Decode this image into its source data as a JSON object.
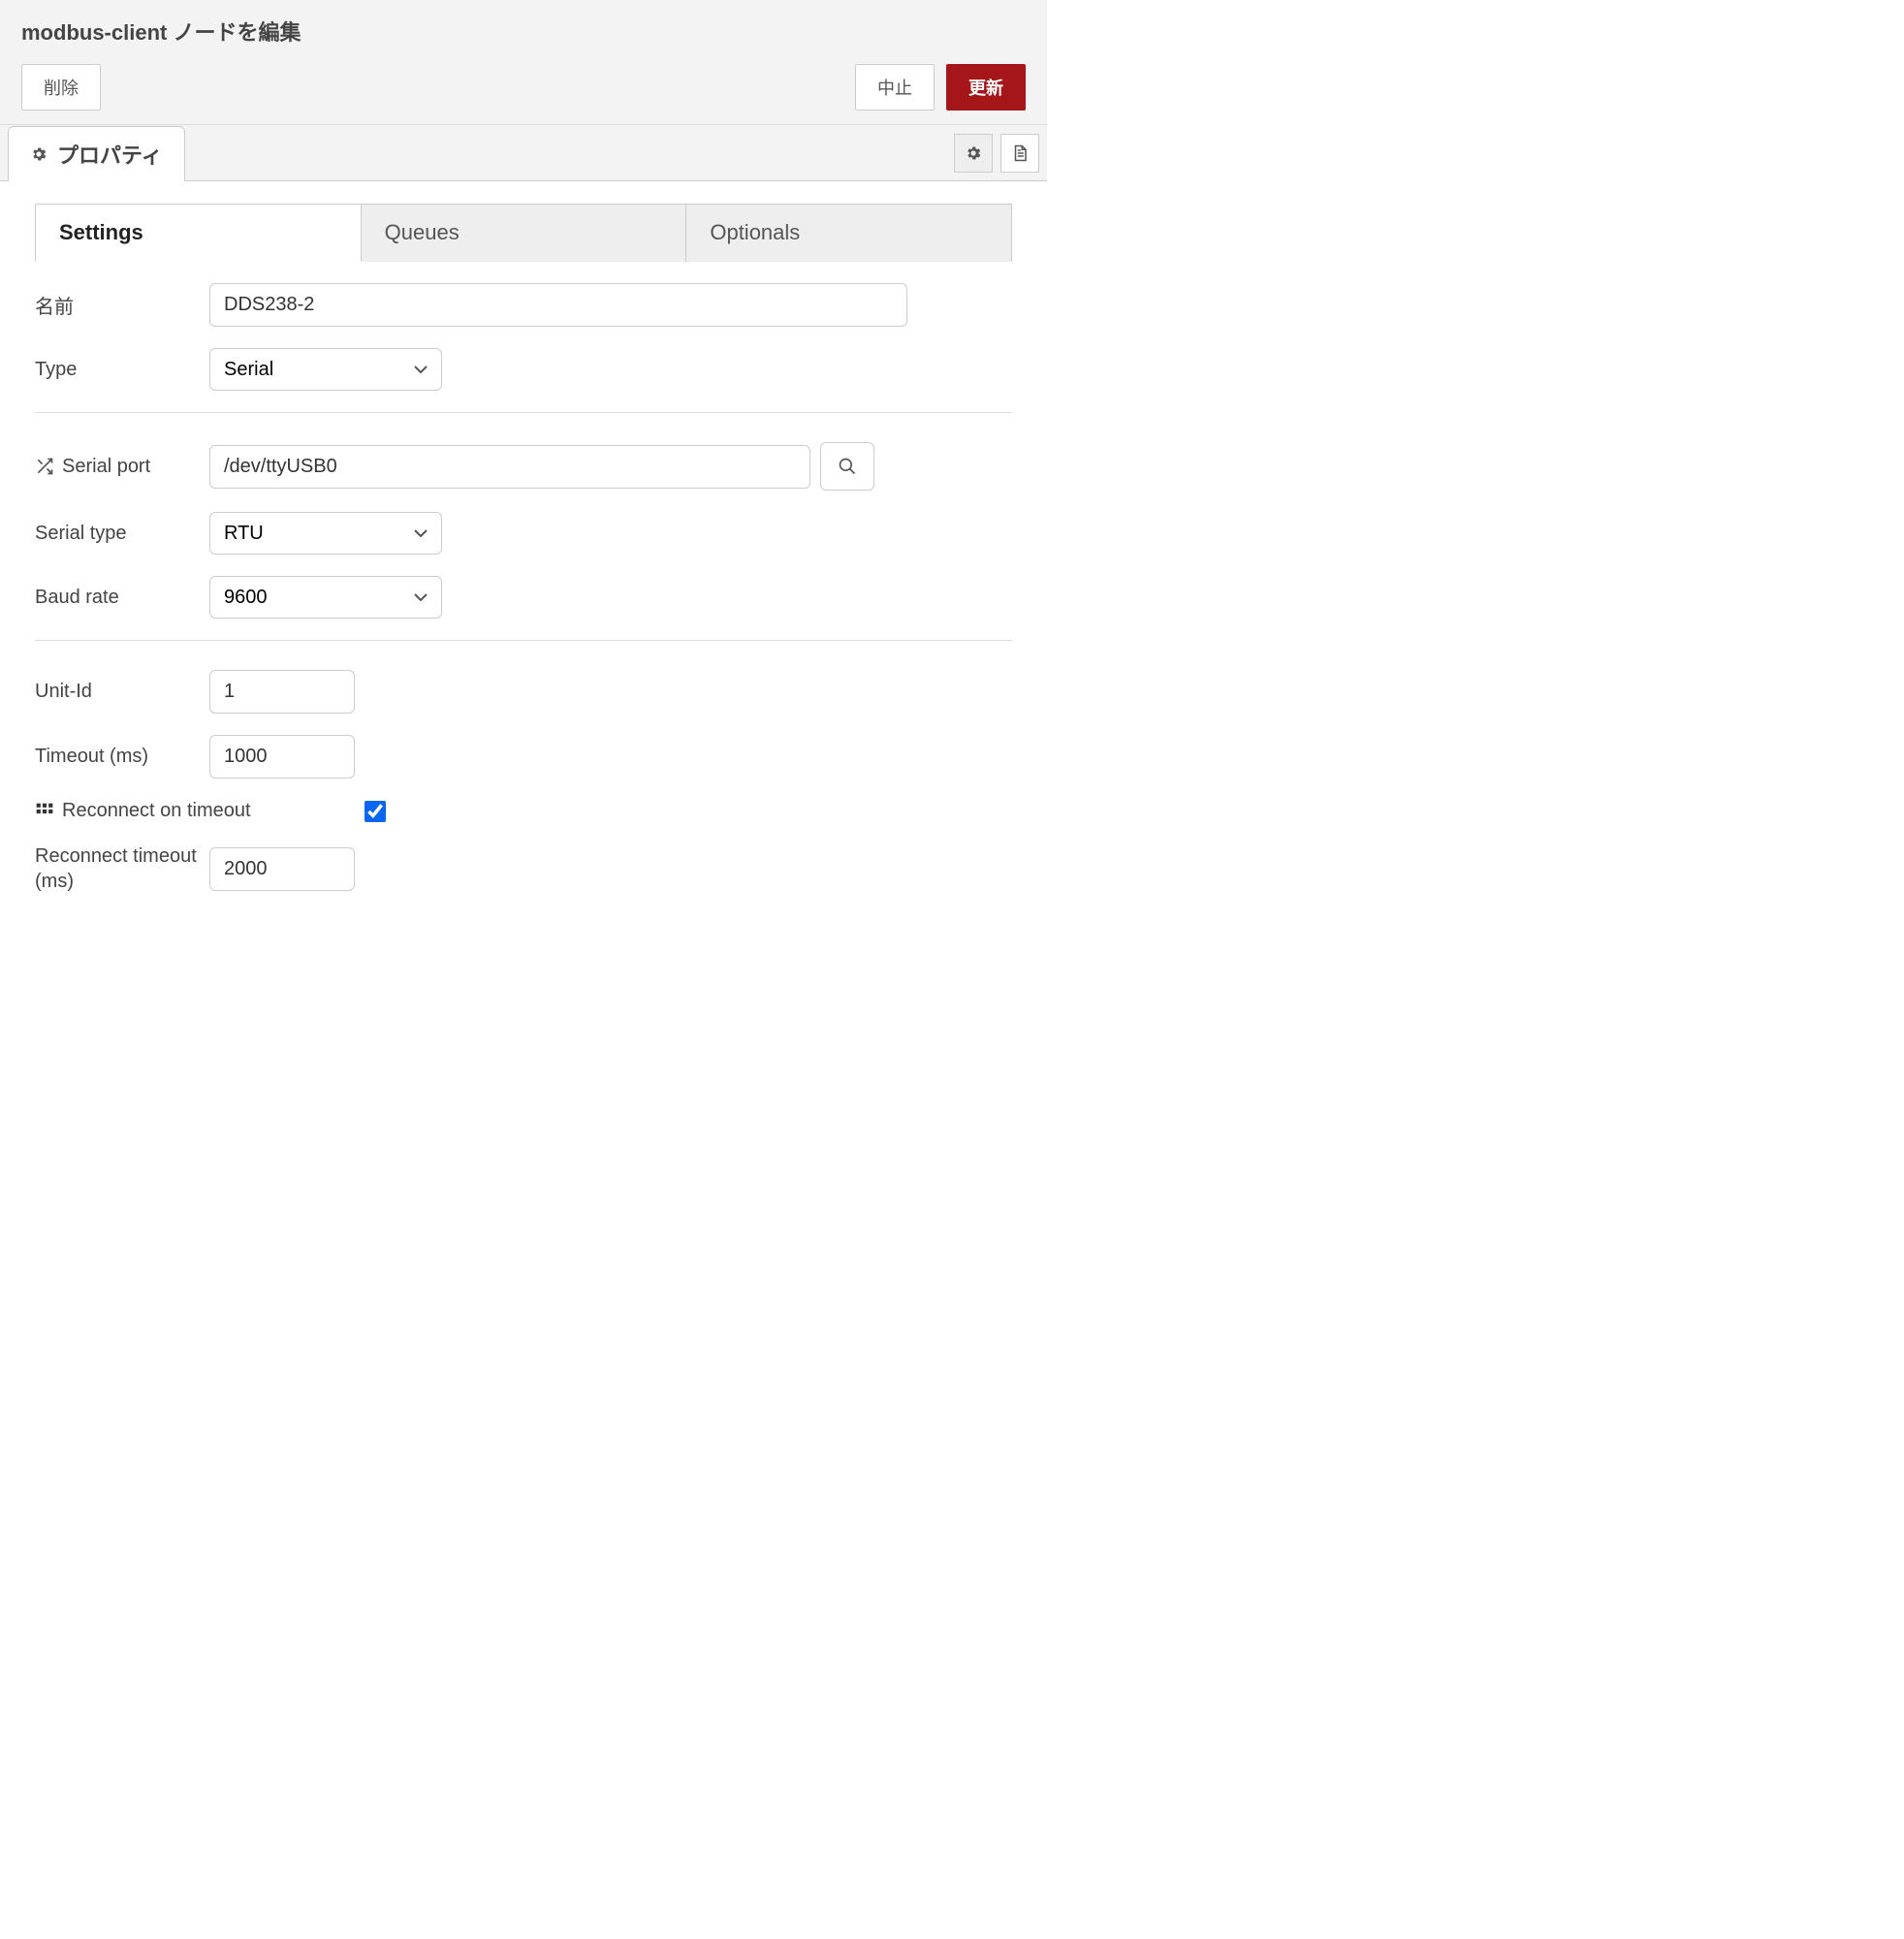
{
  "header": {
    "title": "modbus-client ノードを編集",
    "delete_label": "削除",
    "cancel_label": "中止",
    "update_label": "更新"
  },
  "main_tab": {
    "properties_label": "プロパティ"
  },
  "sub_tabs": {
    "settings": "Settings",
    "queues": "Queues",
    "optionals": "Optionals"
  },
  "form": {
    "name_label": "名前",
    "name_value": "DDS238-2",
    "type_label": "Type",
    "type_value": "Serial",
    "serial_port_label": "Serial port",
    "serial_port_value": "/dev/ttyUSB0",
    "serial_type_label": "Serial type",
    "serial_type_value": "RTU",
    "baud_rate_label": "Baud rate",
    "baud_rate_value": "9600",
    "unit_id_label": "Unit-Id",
    "unit_id_value": "1",
    "timeout_label": "Timeout (ms)",
    "timeout_value": "1000",
    "reconnect_on_timeout_label": "Reconnect on timeout",
    "reconnect_on_timeout_checked": true,
    "reconnect_timeout_label": "Reconnect timeout (ms)",
    "reconnect_timeout_value": "2000"
  }
}
